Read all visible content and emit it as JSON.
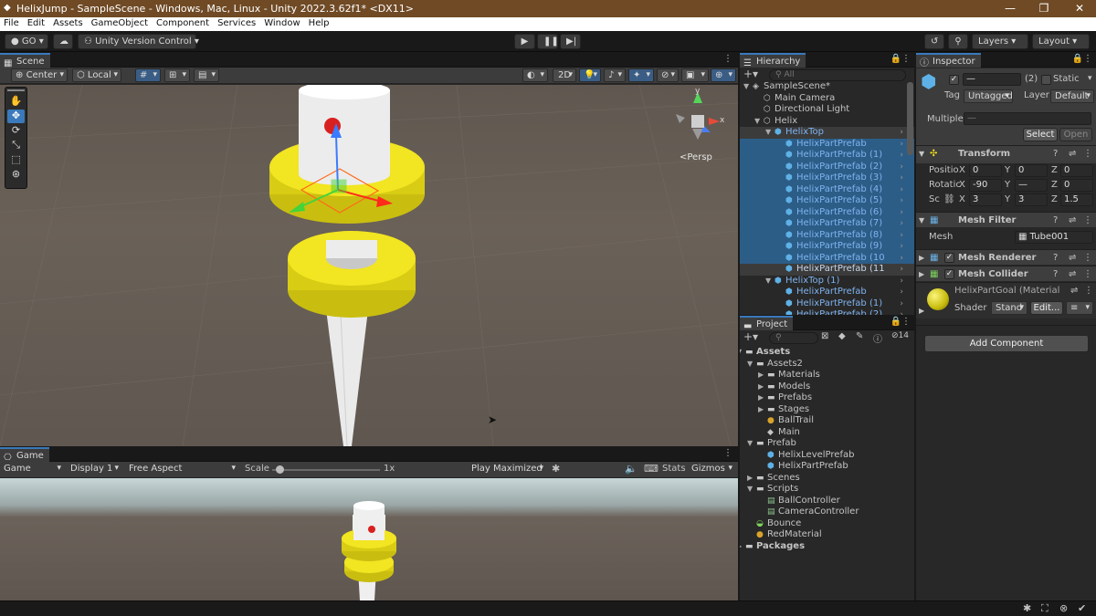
{
  "window": {
    "title": "HelixJump - SampleScene - Windows, Mac, Linux - Unity 2022.3.62f1* <DX11>",
    "controls": [
      "—",
      "❐",
      "✕"
    ]
  },
  "menu": [
    "File",
    "Edit",
    "Assets",
    "GameObject",
    "Component",
    "Services",
    "Window",
    "Help"
  ],
  "toolbar": {
    "account": "GO",
    "version_control": "Unity Version Control",
    "layers": "Layers",
    "layout": "Layout"
  },
  "scene": {
    "tab": "Scene",
    "pivot": "Center",
    "space": "Local",
    "mode_2d": "2D",
    "persp": "<Persp",
    "gizmo_axes": {
      "y": "y",
      "x": "x"
    }
  },
  "game": {
    "tab": "Game",
    "view": "Game",
    "display": "Display 1",
    "aspect": "Free Aspect",
    "scale_label": "Scale",
    "scale_value": 0.03,
    "scale_text": "1x",
    "play_mode": "Play Maximized",
    "stats": "Stats",
    "gizmos": "Gizmos"
  },
  "hierarchy": {
    "tab": "Hierarchy",
    "search_placeholder": "All",
    "items": [
      {
        "label": "SampleScene*",
        "depth": 0,
        "type": "scene",
        "expanded": true
      },
      {
        "label": "Main Camera",
        "depth": 1,
        "type": "obj"
      },
      {
        "label": "Directional Light",
        "depth": 1,
        "type": "obj"
      },
      {
        "label": "Helix",
        "depth": 1,
        "type": "obj",
        "expanded": true
      },
      {
        "label": "HelixTop",
        "depth": 2,
        "type": "prefab",
        "expanded": true,
        "state": "hover"
      },
      {
        "label": "HelixPartPrefab",
        "depth": 3,
        "type": "prefab",
        "state": "selected"
      },
      {
        "label": "HelixPartPrefab (1)",
        "depth": 3,
        "type": "prefab",
        "state": "selected"
      },
      {
        "label": "HelixPartPrefab (2)",
        "depth": 3,
        "type": "prefab",
        "state": "selected"
      },
      {
        "label": "HelixPartPrefab (3)",
        "depth": 3,
        "type": "prefab",
        "state": "selected"
      },
      {
        "label": "HelixPartPrefab (4)",
        "depth": 3,
        "type": "prefab",
        "state": "selected"
      },
      {
        "label": "HelixPartPrefab (5)",
        "depth": 3,
        "type": "prefab",
        "state": "selected"
      },
      {
        "label": "HelixPartPrefab (6)",
        "depth": 3,
        "type": "prefab",
        "state": "selected"
      },
      {
        "label": "HelixPartPrefab (7)",
        "depth": 3,
        "type": "prefab",
        "state": "selected"
      },
      {
        "label": "HelixPartPrefab (8)",
        "depth": 3,
        "type": "prefab",
        "state": "selected"
      },
      {
        "label": "HelixPartPrefab (9)",
        "depth": 3,
        "type": "prefab",
        "state": "selected"
      },
      {
        "label": "HelixPartPrefab (10",
        "depth": 3,
        "type": "prefab",
        "state": "selected"
      },
      {
        "label": "HelixPartPrefab (11",
        "depth": 3,
        "type": "prefab",
        "state": "hover"
      },
      {
        "label": "HelixTop (1)",
        "depth": 2,
        "type": "prefab",
        "expanded": true
      },
      {
        "label": "HelixPartPrefab",
        "depth": 3,
        "type": "prefab"
      },
      {
        "label": "HelixPartPrefab (1)",
        "depth": 3,
        "type": "prefab"
      },
      {
        "label": "HelixPartPrefab (2)",
        "depth": 3,
        "type": "prefab"
      }
    ]
  },
  "project": {
    "tab": "Project",
    "hidden_count": "14",
    "items": [
      {
        "label": "Assets",
        "depth": 0,
        "type": "folder",
        "expanded": true,
        "bold": true
      },
      {
        "label": "Assets2",
        "depth": 1,
        "type": "folder",
        "expanded": true
      },
      {
        "label": "Materials",
        "depth": 2,
        "type": "folder",
        "collapsed": true
      },
      {
        "label": "Models",
        "depth": 2,
        "type": "folder",
        "collapsed": true
      },
      {
        "label": "Prefabs",
        "depth": 2,
        "type": "folder",
        "collapsed": true
      },
      {
        "label": "Stages",
        "depth": 2,
        "type": "folder",
        "collapsed": true
      },
      {
        "label": "BallTrail",
        "depth": 2,
        "type": "material"
      },
      {
        "label": "Main",
        "depth": 2,
        "type": "unity"
      },
      {
        "label": "Prefab",
        "depth": 1,
        "type": "folder",
        "expanded": true
      },
      {
        "label": "HelixLevelPrefab",
        "depth": 2,
        "type": "prefab"
      },
      {
        "label": "HelixPartPrefab",
        "depth": 2,
        "type": "prefab"
      },
      {
        "label": "Scenes",
        "depth": 1,
        "type": "folder",
        "collapsed": true
      },
      {
        "label": "Scripts",
        "depth": 1,
        "type": "folder",
        "expanded": true
      },
      {
        "label": "BallController",
        "depth": 2,
        "type": "script"
      },
      {
        "label": "CameraController",
        "depth": 2,
        "type": "script"
      },
      {
        "label": "Bounce",
        "depth": 1,
        "type": "physic"
      },
      {
        "label": "RedMaterial",
        "depth": 1,
        "type": "material"
      },
      {
        "label": "Packages",
        "depth": 0,
        "type": "folder",
        "collapsed": true,
        "bold": true
      }
    ]
  },
  "inspector": {
    "tab": "Inspector",
    "name_field": "—",
    "count": "(2)",
    "static_label": "Static",
    "tag_label": "Tag",
    "tag_value": "Untagged",
    "layer_label": "Layer",
    "layer_value": "Default",
    "multiple_label": "Multiple",
    "multiple_value": "—",
    "select_btn": "Select",
    "open_btn": "Open",
    "transform": {
      "title": "Transform",
      "position_label": "Positio",
      "rotation_label": "Rotatic",
      "scale_label": "Sc",
      "position": {
        "x": "0",
        "y": "0",
        "z": "0"
      },
      "rotation": {
        "x": "-90",
        "y": "—",
        "z": "0"
      },
      "scale": {
        "x": "3",
        "y": "3",
        "z": "1.5"
      }
    },
    "mesh_filter": {
      "title": "Mesh Filter",
      "mesh_label": "Mesh",
      "mesh_value": "Tube001"
    },
    "mesh_renderer": {
      "title": "Mesh Renderer"
    },
    "mesh_collider": {
      "title": "Mesh Collider"
    },
    "material": {
      "name": "HelixPartGoal (Material",
      "shader_label": "Shader",
      "shader_value": "Stand",
      "edit_btn": "Edit..."
    },
    "add_component": "Add Component"
  },
  "colors": {
    "title_bar": "#6f4a25",
    "accent_blue": "#3a79bb",
    "helix_yellow": "#f2e521",
    "selection": "#2c5d87"
  }
}
